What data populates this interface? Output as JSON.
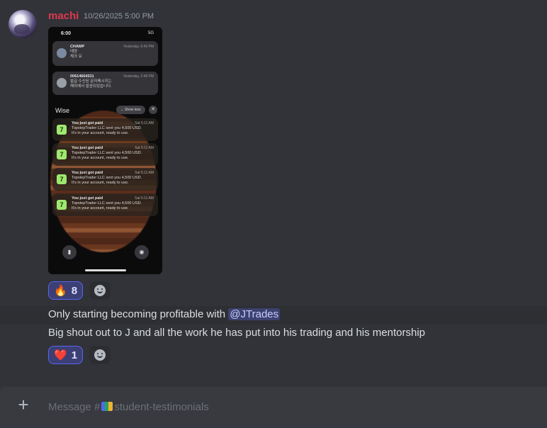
{
  "message": {
    "author": "machi",
    "timestamp": "10/26/2025 5:00 PM",
    "attachment": {
      "phone_status_time": "6:00",
      "phone_status_right": "5G",
      "notifications": [
        {
          "sender": "CHAMP",
          "line1": "태양",
          "line2": "체크 요",
          "time": "Yesterday, 6:49 PM"
        },
        {
          "sender": "00614664531",
          "line1": "발급 수신된 문자메시지는",
          "line2": "해외에서 발송되었습니다.",
          "time": "Yesterday, 2:48 PM"
        }
      ],
      "group_app": "Wise",
      "show_less": "Show less",
      "wise_items": [
        {
          "title": "You just got paid",
          "line1": "TopstepTrader LLC sent you 4,500 USD.",
          "line2": "It's in your account, ready to use.",
          "time": "Sat 5:11 AM"
        },
        {
          "title": "You just got paid",
          "line1": "TopstepTrader LLC sent you 4,500 USD.",
          "line2": "It's in your account, ready to use.",
          "time": "Sat 5:11 AM"
        },
        {
          "title": "You just got paid",
          "line1": "TopstepTrader LLC sent you 4,500 USD.",
          "line2": "It's in your account, ready to use.",
          "time": "Sat 5:11 AM"
        },
        {
          "title": "You just got paid",
          "line1": "TopstepTrader LLC sent you 4,500 USD.",
          "line2": "It's in your account, ready to use.",
          "time": "Sat 5:11 AM"
        }
      ]
    },
    "reactions_image": [
      {
        "emoji": "🔥",
        "count": "8"
      }
    ],
    "line1_prefix": "Only starting becoming profitable with ",
    "line1_mention": "@JTrades",
    "line2": "Big shout out to J and all the work he has put into his trading and his mentorship",
    "reactions_text": [
      {
        "emoji": "❤️",
        "count": "1"
      }
    ]
  },
  "composer": {
    "placeholder_prefix": "Message #",
    "channel": "student-testimonials"
  },
  "colors": {
    "username": "#e0384f",
    "background": "#313338",
    "mention_bg": "#3c4270",
    "reaction_border": "#5865f2"
  }
}
